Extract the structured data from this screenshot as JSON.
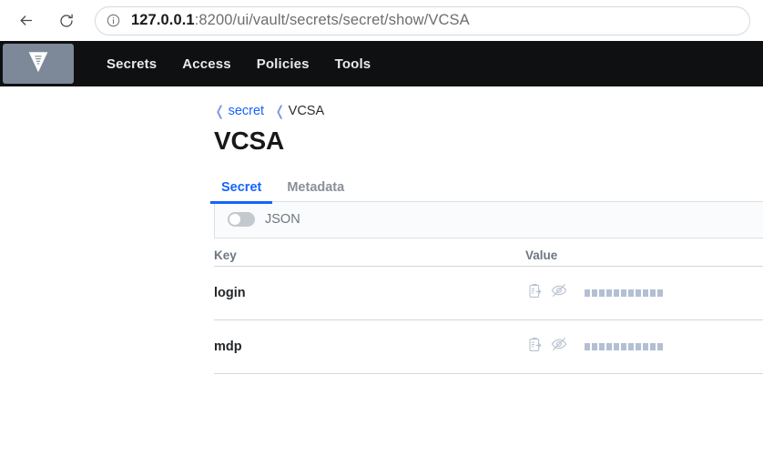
{
  "browser": {
    "back_icon": "back-arrow-icon",
    "reload_icon": "reload-icon",
    "info_icon": "info-circle-icon",
    "url_host": "127.0.0.1",
    "url_path": ":8200/ui/vault/secrets/secret/show/VCSA",
    "url_full": "127.0.0.1:8200/ui/vault/secrets/secret/show/VCSA"
  },
  "nav": {
    "logo_icon": "vault-logo-icon",
    "links": [
      {
        "label": "Secrets"
      },
      {
        "label": "Access"
      },
      {
        "label": "Policies"
      },
      {
        "label": "Tools"
      }
    ],
    "background_color": "#0f1011",
    "logo_background_color": "#7d8898"
  },
  "breadcrumb": {
    "chevron_icon": "chevron-left-icon",
    "items": [
      {
        "label": "secret",
        "link": true
      },
      {
        "label": "VCSA",
        "link": false
      }
    ]
  },
  "page": {
    "title": "VCSA"
  },
  "tabs": [
    {
      "label": "Secret",
      "active": true
    },
    {
      "label": "Metadata",
      "active": false
    }
  ],
  "json_toggle": {
    "label": "JSON",
    "enabled": false
  },
  "table": {
    "headers": {
      "key": "Key",
      "value": "Value"
    },
    "rows": [
      {
        "key": "login",
        "copy_icon": "copy-clipboard-icon",
        "visibility_icon": "eye-off-icon",
        "value_masked": true,
        "mask_char_count": 11
      },
      {
        "key": "mdp",
        "copy_icon": "copy-clipboard-icon",
        "visibility_icon": "eye-off-icon",
        "value_masked": true,
        "mask_char_count": 11
      }
    ]
  },
  "colors": {
    "accent_blue": "#1563ff",
    "nav_dark": "#0f1011",
    "muted_text": "#6d7684",
    "mask_square": "#b4bfd4"
  }
}
